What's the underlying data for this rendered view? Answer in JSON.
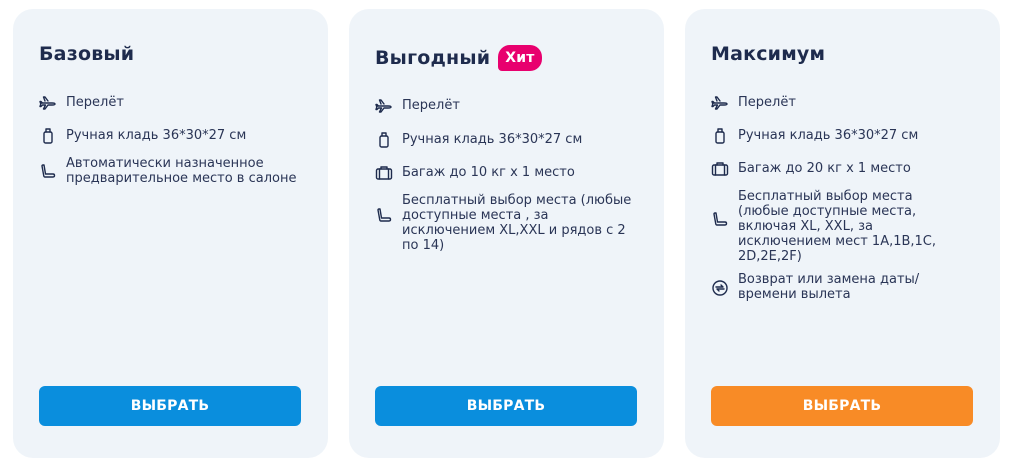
{
  "cards": [
    {
      "title": "Базовый",
      "features": [
        {
          "icon": "plane-icon",
          "text": "Перелёт"
        },
        {
          "icon": "hand-luggage-icon",
          "text": "Ручная кладь 36*30*27 см"
        },
        {
          "icon": "seat-icon",
          "text": "Автоматически назначенное предварительное место в салоне"
        }
      ],
      "button_label": "ВЫБРАТЬ"
    },
    {
      "title": "Выгодный",
      "badge": "Хит",
      "features": [
        {
          "icon": "plane-icon",
          "text": "Перелёт"
        },
        {
          "icon": "hand-luggage-icon",
          "text": "Ручная кладь 36*30*27 см"
        },
        {
          "icon": "suitcase-icon",
          "text": "Багаж до 10 кг х 1 место"
        },
        {
          "icon": "seat-icon",
          "text": "Бесплатный выбор места (любые доступные места , за исключением XL,XXL и рядов с 2 по 14)"
        }
      ],
      "button_label": "ВЫБРАТЬ"
    },
    {
      "title": "Максимум",
      "features": [
        {
          "icon": "plane-icon",
          "text": "Перелёт"
        },
        {
          "icon": "hand-luggage-icon",
          "text": "Ручная кладь 36*30*27 см"
        },
        {
          "icon": "suitcase-icon",
          "text": "Багаж до 20 кг х 1 место"
        },
        {
          "icon": "seat-icon",
          "text": "Бесплатный выбор места (любые доступные места, включая XL, XXL, за исключением мест 1A,1B,1C, 2D,2E,2F)"
        },
        {
          "icon": "exchange-icon",
          "text": "Возврат или замена даты/времени вылета"
        }
      ],
      "button_label": "ВЫБРАТЬ"
    }
  ],
  "colors": {
    "card_bg": "#eff4f9",
    "text": "#1e2b4d",
    "button_blue": "#0a8edd",
    "button_orange": "#f88b26",
    "badge": "#e8006e"
  }
}
